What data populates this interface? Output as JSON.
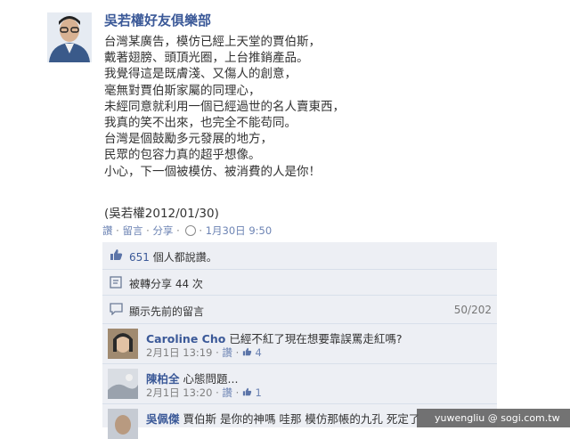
{
  "post": {
    "poster_name": "吳若權好友俱樂部",
    "lines": [
      "台灣某廣告，模仿已經上天堂的賈伯斯，",
      "戴著翅膀、頭頂光圈，上台推銷產品。",
      "我覺得這是既膚淺、又傷人的創意，",
      "毫無對賈伯斯家屬的同理心，",
      "未經同意就利用一個已經過世的名人賣東西，",
      "我真的笑不出來，也完全不能苟同。",
      "台灣是個鼓勵多元發展的地方，",
      "民眾的包容力真的超乎想像。",
      "小心，下一個被模仿、被消費的人是你！"
    ],
    "signature": "(吳若權2012/01/30)",
    "actions": {
      "like": "讚",
      "comment": "留言",
      "share": "分享",
      "sep": "·",
      "timestamp": "1月30日 9:50"
    }
  },
  "likes": {
    "count": "651",
    "text": "個人都說讚。"
  },
  "shares": {
    "text": "被轉分享 44 次"
  },
  "previous_comments": {
    "label": "顯示先前的留言",
    "count": "50/202"
  },
  "comments": [
    {
      "name": "Caroline Cho",
      "text": "已經不紅了現在想要靠誤罵走紅嗎?",
      "time": "2月1日 13:19",
      "like": "讚",
      "likes": "4"
    },
    {
      "name": "陳柏全",
      "text": "心態問題...",
      "time": "2月1日 13:20",
      "like": "讚",
      "likes": "1"
    },
    {
      "name": "吳佩傑",
      "text": "賈伯斯 是你的神嗎 哇那 模仿那帳的九孔 死定了",
      "time": "",
      "like": "",
      "likes": ""
    }
  ],
  "watermark": {
    "text": "yuwengliu   @ sogi.com.tw"
  }
}
